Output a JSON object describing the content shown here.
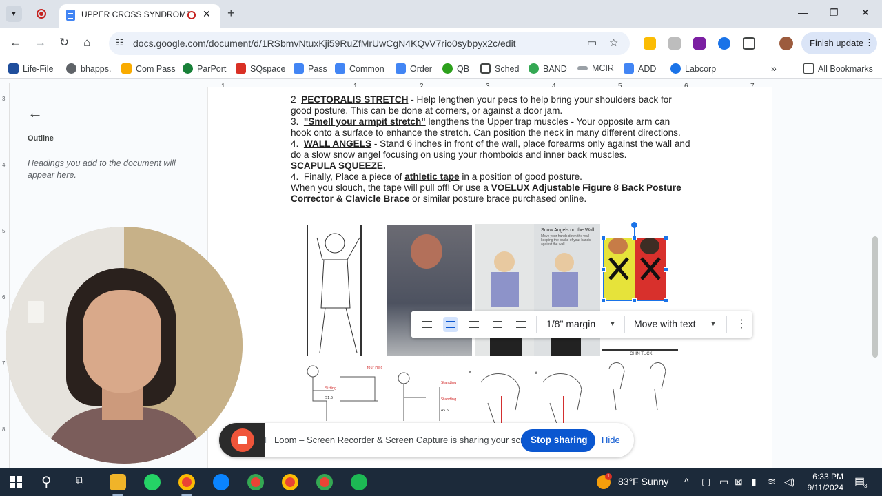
{
  "browser": {
    "tab_title": "UPPER CROSS SYNDROME",
    "url": "docs.google.com/document/d/1RSbmvNtuxKji59RuZfMrUwCgN4KQvV7rio0sybpyx2c/edit",
    "finish_update_label": "Finish update",
    "bookmarks": [
      {
        "label": "Life-File",
        "color": "#1f4e9c"
      },
      {
        "label": "bhapps.",
        "color": "#5f6368"
      },
      {
        "label": "Com Pass",
        "color": "#f9ab00"
      },
      {
        "label": "ParPort",
        "color": "#188038"
      },
      {
        "label": "SQspace",
        "color": "#d93025"
      },
      {
        "label": "Pass",
        "color": "#4285f4"
      },
      {
        "label": "Common",
        "color": "#4285f4"
      },
      {
        "label": "Order",
        "color": "#4285f4"
      },
      {
        "label": "QB",
        "color": "#2ca01c"
      },
      {
        "label": "Sched",
        "color": "#444746"
      },
      {
        "label": "BAND",
        "color": "#34a853"
      },
      {
        "label": "MCIR",
        "color": "#5f6368"
      },
      {
        "label": "ADD",
        "color": "#4285f4"
      },
      {
        "label": "Labcorp",
        "color": "#1a73e8"
      }
    ],
    "all_bookmarks_label": "All Bookmarks"
  },
  "ruler": {
    "numbers": [
      "1",
      "1",
      "2",
      "3",
      "4",
      "5",
      "6",
      "7"
    ],
    "vertical": [
      "3",
      "4",
      "5",
      "6",
      "7",
      "8"
    ]
  },
  "outline": {
    "label": "Outline",
    "hint": "Headings you add to the document will appear here."
  },
  "document": {
    "p1_num": "2",
    "p1_title": "PECTORALIS STRETCH",
    "p1_text": " - Help lengthen your pecs to help bring your shoulders back for good posture.  This can be done at corners, or against a door jam.",
    "p2_num": "3.",
    "p2_title": "\"Smell your armpit stretch\"",
    "p2_text": " lengthens the Upper trap muscles - Your opposite arm can hook onto a surface to enhance the stretch.  Can position the neck in many different directions.",
    "p3_num": "4.",
    "p3_title": "WALL ANGELS",
    "p3_text": " - Stand 6 inches in front of the wall, place forearms only against the wall and do a slow snow angel focusing on using your rhomboids and inner back muscles.",
    "p4_bold": "SCAPULA SQUEEZE.",
    "p5_num": "4.",
    "p5_pre": "Finally,  Place a piece of ",
    "p5_link": "athletic tape",
    "p5_text": " in a position of good posture.",
    "p6_pre": "When you slouch, the tape will pull off!  Or use a ",
    "p6_bold": "VOELUX Adjustable Figure 8 Back Posture Corrector & Clavicle Brace",
    "p6_text": " or similar posture brace purchased online.",
    "snow_angels_caption": "Snow Angels on the Wall",
    "snow_angels_sub": "Move your hands down the wall keeping the backs of your hands against the wall",
    "chin_tuck_label": "CHIN TUCK"
  },
  "image_toolbar": {
    "margin_label": "1/8\" margin",
    "move_label": "Move with text"
  },
  "loom": {
    "message": "Loom – Screen Recorder & Screen Capture is sharing your screen.",
    "stop_label": "Stop sharing",
    "hide_label": "Hide"
  },
  "taskbar": {
    "weather": "83°F  Sunny",
    "weather_badge": "1",
    "time": "6:33 PM",
    "date": "9/11/2024",
    "notif_count": "3"
  }
}
